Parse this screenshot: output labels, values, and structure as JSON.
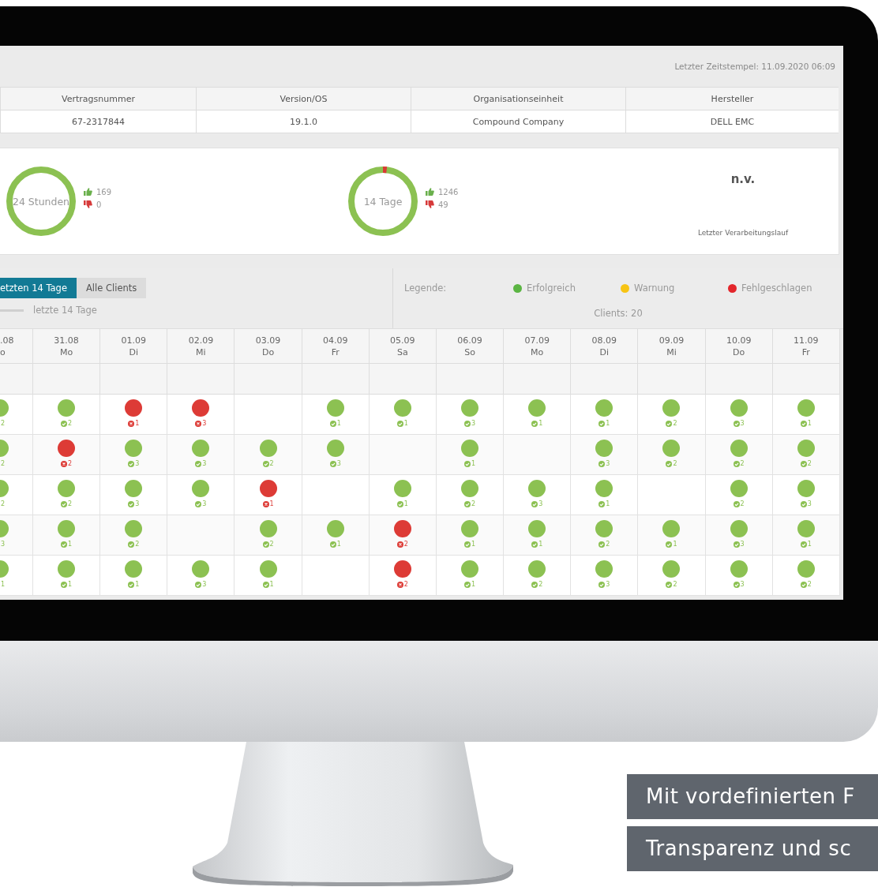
{
  "header": {
    "timestamp": "Letzter Zeitstempel: 11.09.2020 06:09"
  },
  "info_table": {
    "columns": [
      "Vertragsnummer",
      "Version/OS",
      "Organisationseinheit",
      "Hersteller"
    ],
    "values": [
      "67-2317844",
      "19.1.0",
      "Compound Company",
      "DELL EMC"
    ]
  },
  "summary": {
    "periods": [
      {
        "label": "24 Stunden",
        "success_count": "169",
        "failure_count": "0"
      },
      {
        "label": "14 Tage",
        "success_count": "1246",
        "failure_count": "49"
      }
    ],
    "last_run": {
      "value": "n.v.",
      "label": "Letzter Verarbeitungslauf"
    }
  },
  "filter": {
    "tabs": [
      {
        "label": "etzten 14 Tage",
        "selected": true
      },
      {
        "label": "Alle Clients",
        "selected": false
      }
    ],
    "range_label": "letzte 14 Tage",
    "legend_title": "Legende:",
    "legend": [
      {
        "label": "Erfolgreich",
        "color": "#5bb543"
      },
      {
        "label": "Warnung",
        "color": "#f7c414"
      },
      {
        "label": "Fehlgeschlagen",
        "color": "#e3262b"
      }
    ],
    "clients": "Clients: 20"
  },
  "grid": {
    "columns": [
      {
        "date": ".08",
        "day": "o"
      },
      {
        "date": "31.08",
        "day": "Mo"
      },
      {
        "date": "01.09",
        "day": "Di"
      },
      {
        "date": "02.09",
        "day": "Mi"
      },
      {
        "date": "03.09",
        "day": "Do"
      },
      {
        "date": "04.09",
        "day": "Fr"
      },
      {
        "date": "05.09",
        "day": "Sa"
      },
      {
        "date": "06.09",
        "day": "So"
      },
      {
        "date": "07.09",
        "day": "Mo"
      },
      {
        "date": "08.09",
        "day": "Di"
      },
      {
        "date": "09.09",
        "day": "Mi"
      },
      {
        "date": "10.09",
        "day": "Do"
      },
      {
        "date": "11.09",
        "day": "Fr"
      }
    ],
    "rows": [
      {
        "cells": [
          {
            "kind": "success",
            "color": "#8cc152",
            "count": "2"
          },
          {
            "kind": "success",
            "color": "#8cc152",
            "count": "2"
          },
          {
            "kind": "failed",
            "color": "#dd3b36",
            "count": "1"
          },
          {
            "kind": "failed",
            "color": "#dd3b36",
            "count": "3"
          },
          null,
          {
            "kind": "success",
            "color": "#8cc152",
            "count": "1"
          },
          {
            "kind": "success",
            "color": "#8cc152",
            "count": "1"
          },
          {
            "kind": "success",
            "color": "#8cc152",
            "count": "3"
          },
          {
            "kind": "success",
            "color": "#8cc152",
            "count": "1"
          },
          {
            "kind": "success",
            "color": "#8cc152",
            "count": "1"
          },
          {
            "kind": "success",
            "color": "#8cc152",
            "count": "2"
          },
          {
            "kind": "success",
            "color": "#8cc152",
            "count": "3"
          },
          {
            "kind": "success",
            "color": "#8cc152",
            "count": "1"
          }
        ]
      },
      {
        "cells": [
          {
            "kind": "success",
            "color": "#8cc152",
            "count": "2"
          },
          {
            "kind": "failed",
            "color": "#dd3b36",
            "count": "2"
          },
          {
            "kind": "success",
            "color": "#8cc152",
            "count": "3"
          },
          {
            "kind": "success",
            "color": "#8cc152",
            "count": "3"
          },
          {
            "kind": "success",
            "color": "#8cc152",
            "count": "2"
          },
          {
            "kind": "success",
            "color": "#8cc152",
            "count": "3"
          },
          null,
          {
            "kind": "success",
            "color": "#8cc152",
            "count": "1"
          },
          null,
          {
            "kind": "success",
            "color": "#8cc152",
            "count": "3"
          },
          {
            "kind": "success",
            "color": "#8cc152",
            "count": "2"
          },
          {
            "kind": "success",
            "color": "#8cc152",
            "count": "2"
          },
          {
            "kind": "success",
            "color": "#8cc152",
            "count": "2"
          }
        ]
      },
      {
        "cells": [
          {
            "kind": "success",
            "color": "#8cc152",
            "count": "2"
          },
          {
            "kind": "success",
            "color": "#8cc152",
            "count": "2"
          },
          {
            "kind": "success",
            "color": "#8cc152",
            "count": "3"
          },
          {
            "kind": "success",
            "color": "#8cc152",
            "count": "3"
          },
          {
            "kind": "failed",
            "color": "#dd3b36",
            "count": "1"
          },
          null,
          {
            "kind": "success",
            "color": "#8cc152",
            "count": "1"
          },
          {
            "kind": "success",
            "color": "#8cc152",
            "count": "2"
          },
          {
            "kind": "success",
            "color": "#8cc152",
            "count": "3"
          },
          {
            "kind": "success",
            "color": "#8cc152",
            "count": "1"
          },
          null,
          {
            "kind": "success",
            "color": "#8cc152",
            "count": "2"
          },
          {
            "kind": "success",
            "color": "#8cc152",
            "count": "3"
          }
        ]
      },
      {
        "cells": [
          {
            "kind": "success",
            "color": "#8cc152",
            "count": "3"
          },
          {
            "kind": "success",
            "color": "#8cc152",
            "count": "1"
          },
          {
            "kind": "success",
            "color": "#8cc152",
            "count": "2"
          },
          null,
          {
            "kind": "success",
            "color": "#8cc152",
            "count": "2"
          },
          {
            "kind": "success",
            "color": "#8cc152",
            "count": "1"
          },
          {
            "kind": "failed",
            "color": "#dd3b36",
            "count": "2"
          },
          {
            "kind": "success",
            "color": "#8cc152",
            "count": "1"
          },
          {
            "kind": "success",
            "color": "#8cc152",
            "count": "1"
          },
          {
            "kind": "success",
            "color": "#8cc152",
            "count": "2"
          },
          {
            "kind": "success",
            "color": "#8cc152",
            "count": "1"
          },
          {
            "kind": "success",
            "color": "#8cc152",
            "count": "3"
          },
          {
            "kind": "success",
            "color": "#8cc152",
            "count": "1"
          }
        ]
      },
      {
        "cells": [
          {
            "kind": "success",
            "color": "#8cc152",
            "count": "1"
          },
          {
            "kind": "success",
            "color": "#8cc152",
            "count": "1"
          },
          {
            "kind": "success",
            "color": "#8cc152",
            "count": "1"
          },
          {
            "kind": "success",
            "color": "#8cc152",
            "count": "3"
          },
          {
            "kind": "success",
            "color": "#8cc152",
            "count": "1"
          },
          null,
          {
            "kind": "failed",
            "color": "#dd3b36",
            "count": "2"
          },
          {
            "kind": "success",
            "color": "#8cc152",
            "count": "1"
          },
          {
            "kind": "success",
            "color": "#8cc152",
            "count": "2"
          },
          {
            "kind": "success",
            "color": "#8cc152",
            "count": "3"
          },
          {
            "kind": "success",
            "color": "#8cc152",
            "count": "2"
          },
          {
            "kind": "success",
            "color": "#8cc152",
            "count": "3"
          },
          {
            "kind": "success",
            "color": "#8cc152",
            "count": "2"
          }
        ]
      }
    ]
  },
  "captions": [
    "Mit vordefinierten F",
    "Transparenz und sc"
  ]
}
